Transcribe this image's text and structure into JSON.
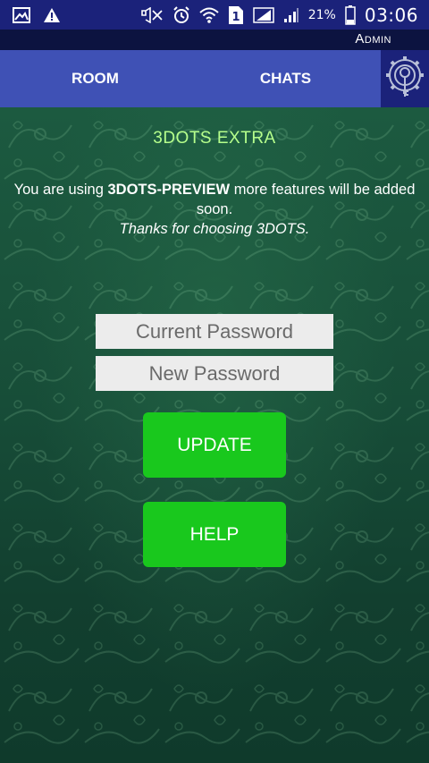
{
  "status_bar": {
    "icons": [
      "gallery-icon",
      "warning-icon",
      "mute-icon",
      "alarm-icon",
      "wifi-icon",
      "sim-1-icon",
      "signal-icon",
      "signal-icon-2",
      "battery-icon"
    ],
    "sim_number": "1",
    "battery_percent": "21%",
    "time": "03:06"
  },
  "admin": {
    "label": "Admin"
  },
  "tabs": [
    {
      "label": "ROOM"
    },
    {
      "label": "CHATS"
    }
  ],
  "settings_icon": "gear-key-icon",
  "main": {
    "title": "3DOTS EXTRA",
    "message_prefix": "You are using ",
    "message_bold": "3DOTS-PREVIEW",
    "message_suffix": " more features will be added soon.",
    "message_thanks": "Thanks for choosing 3DOTS.",
    "current_password_placeholder": "Current Password",
    "new_password_placeholder": "New Password",
    "update_label": "UPDATE",
    "help_label": "HELP"
  },
  "colors": {
    "status_bar": "#1b227a",
    "tab_bar": "#3f51b5",
    "title": "#b6ff8c",
    "button": "#19c81d",
    "background": "#174d38"
  }
}
